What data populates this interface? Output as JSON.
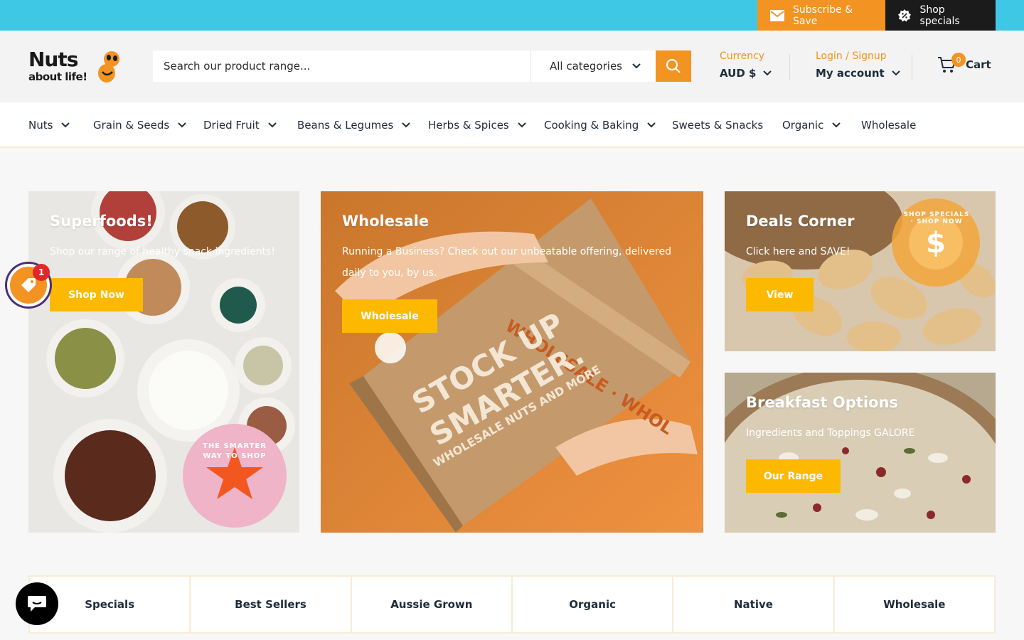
{
  "topbar": {
    "subscribe_label": "Subscribe & Save",
    "specials_label": "Shop specials"
  },
  "header": {
    "logo_line1": "Nuts",
    "logo_line2": "about life!",
    "search_placeholder": "Search our product range...",
    "category_select": "All categories",
    "currency_label": "Currency",
    "currency_value": "AUD $",
    "login_label": "Login / Signup",
    "account_label": "My account",
    "cart_count": "0",
    "cart_label": "Cart"
  },
  "nav": {
    "items": [
      {
        "label": "Nuts"
      },
      {
        "label": "Grain & Seeds"
      },
      {
        "label": "Dried Fruit"
      },
      {
        "label": "Beans & Legumes"
      },
      {
        "label": "Herbs & Spices"
      },
      {
        "label": "Cooking & Baking"
      },
      {
        "label": "Sweets & Snacks"
      },
      {
        "label": "Organic"
      },
      {
        "label": "Wholesale"
      }
    ]
  },
  "banners": {
    "superfoods": {
      "title": "Superfoods!",
      "text": "Shop our range of healthy snack ingredients!",
      "button": "Shop Now",
      "sticker": "THE SMARTER WAY TO SHOP"
    },
    "wholesale": {
      "title": "Wholesale",
      "text": "Running a Business? Check out our unbeatable offering, delivered daily to you, by us.",
      "button": "Wholesale",
      "box_text1": "STOCK UP",
      "box_text2": "SMARTER.",
      "box_text3": "WHOLESALE NUTS AND MORE",
      "box_tape": "WHOLESALE · WHOL"
    },
    "deals": {
      "title": "Deals Corner",
      "text": "Click here and SAVE!",
      "button": "View",
      "sticker": "SHOP SPECIALS · SHOP NOW"
    },
    "breakfast": {
      "title": "Breakfast Options",
      "text": "Ingredients and Toppings GALORE",
      "button": "Our Range"
    }
  },
  "categories": [
    {
      "label": "Specials"
    },
    {
      "label": "Best Sellers"
    },
    {
      "label": "Aussie Grown"
    },
    {
      "label": "Organic"
    },
    {
      "label": "Native"
    },
    {
      "label": "Wholesale"
    }
  ],
  "widgets": {
    "promo_count": "1"
  },
  "colors": {
    "topbar": "#3ec8e6",
    "accent_orange": "#f39322",
    "button_yellow": "#fcb900",
    "dark": "#1e2d3b"
  }
}
